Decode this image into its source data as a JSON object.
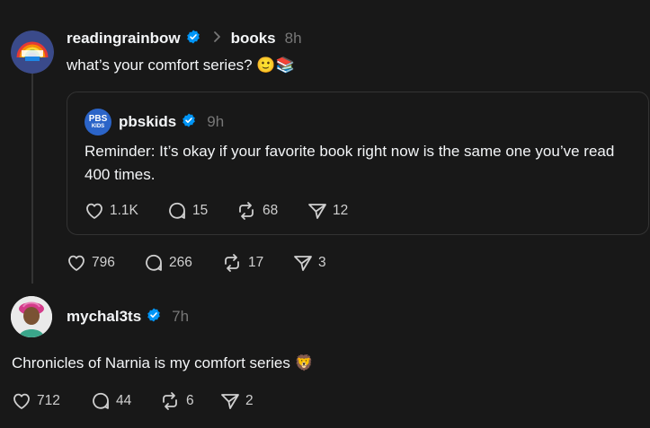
{
  "post1": {
    "username": "readingrainbow",
    "chevron_icon": "chevron-right-icon",
    "community": "books",
    "time": "8h",
    "text": "what’s your comfort series? 🙂📚",
    "quote": {
      "username": "pbskids",
      "time": "9h",
      "avatar_text_top": "PBS",
      "avatar_text_bottom": "KIDS",
      "text": "Reminder: It’s okay if your favorite book right now is the same one you’ve read 400 times.",
      "likes": "1.1K",
      "replies": "15",
      "reposts": "68",
      "shares": "12"
    },
    "likes": "796",
    "replies": "266",
    "reposts": "17",
    "shares": "3"
  },
  "post2": {
    "username": "mychal3ts",
    "time": "7h",
    "text": "Chronicles of Narnia is my comfort series 🦁",
    "likes": "712",
    "replies": "44",
    "reposts": "6",
    "shares": "2"
  },
  "colors": {
    "background": "#181818",
    "verified": "#0095f6",
    "muted": "#777777",
    "border": "#333333"
  }
}
